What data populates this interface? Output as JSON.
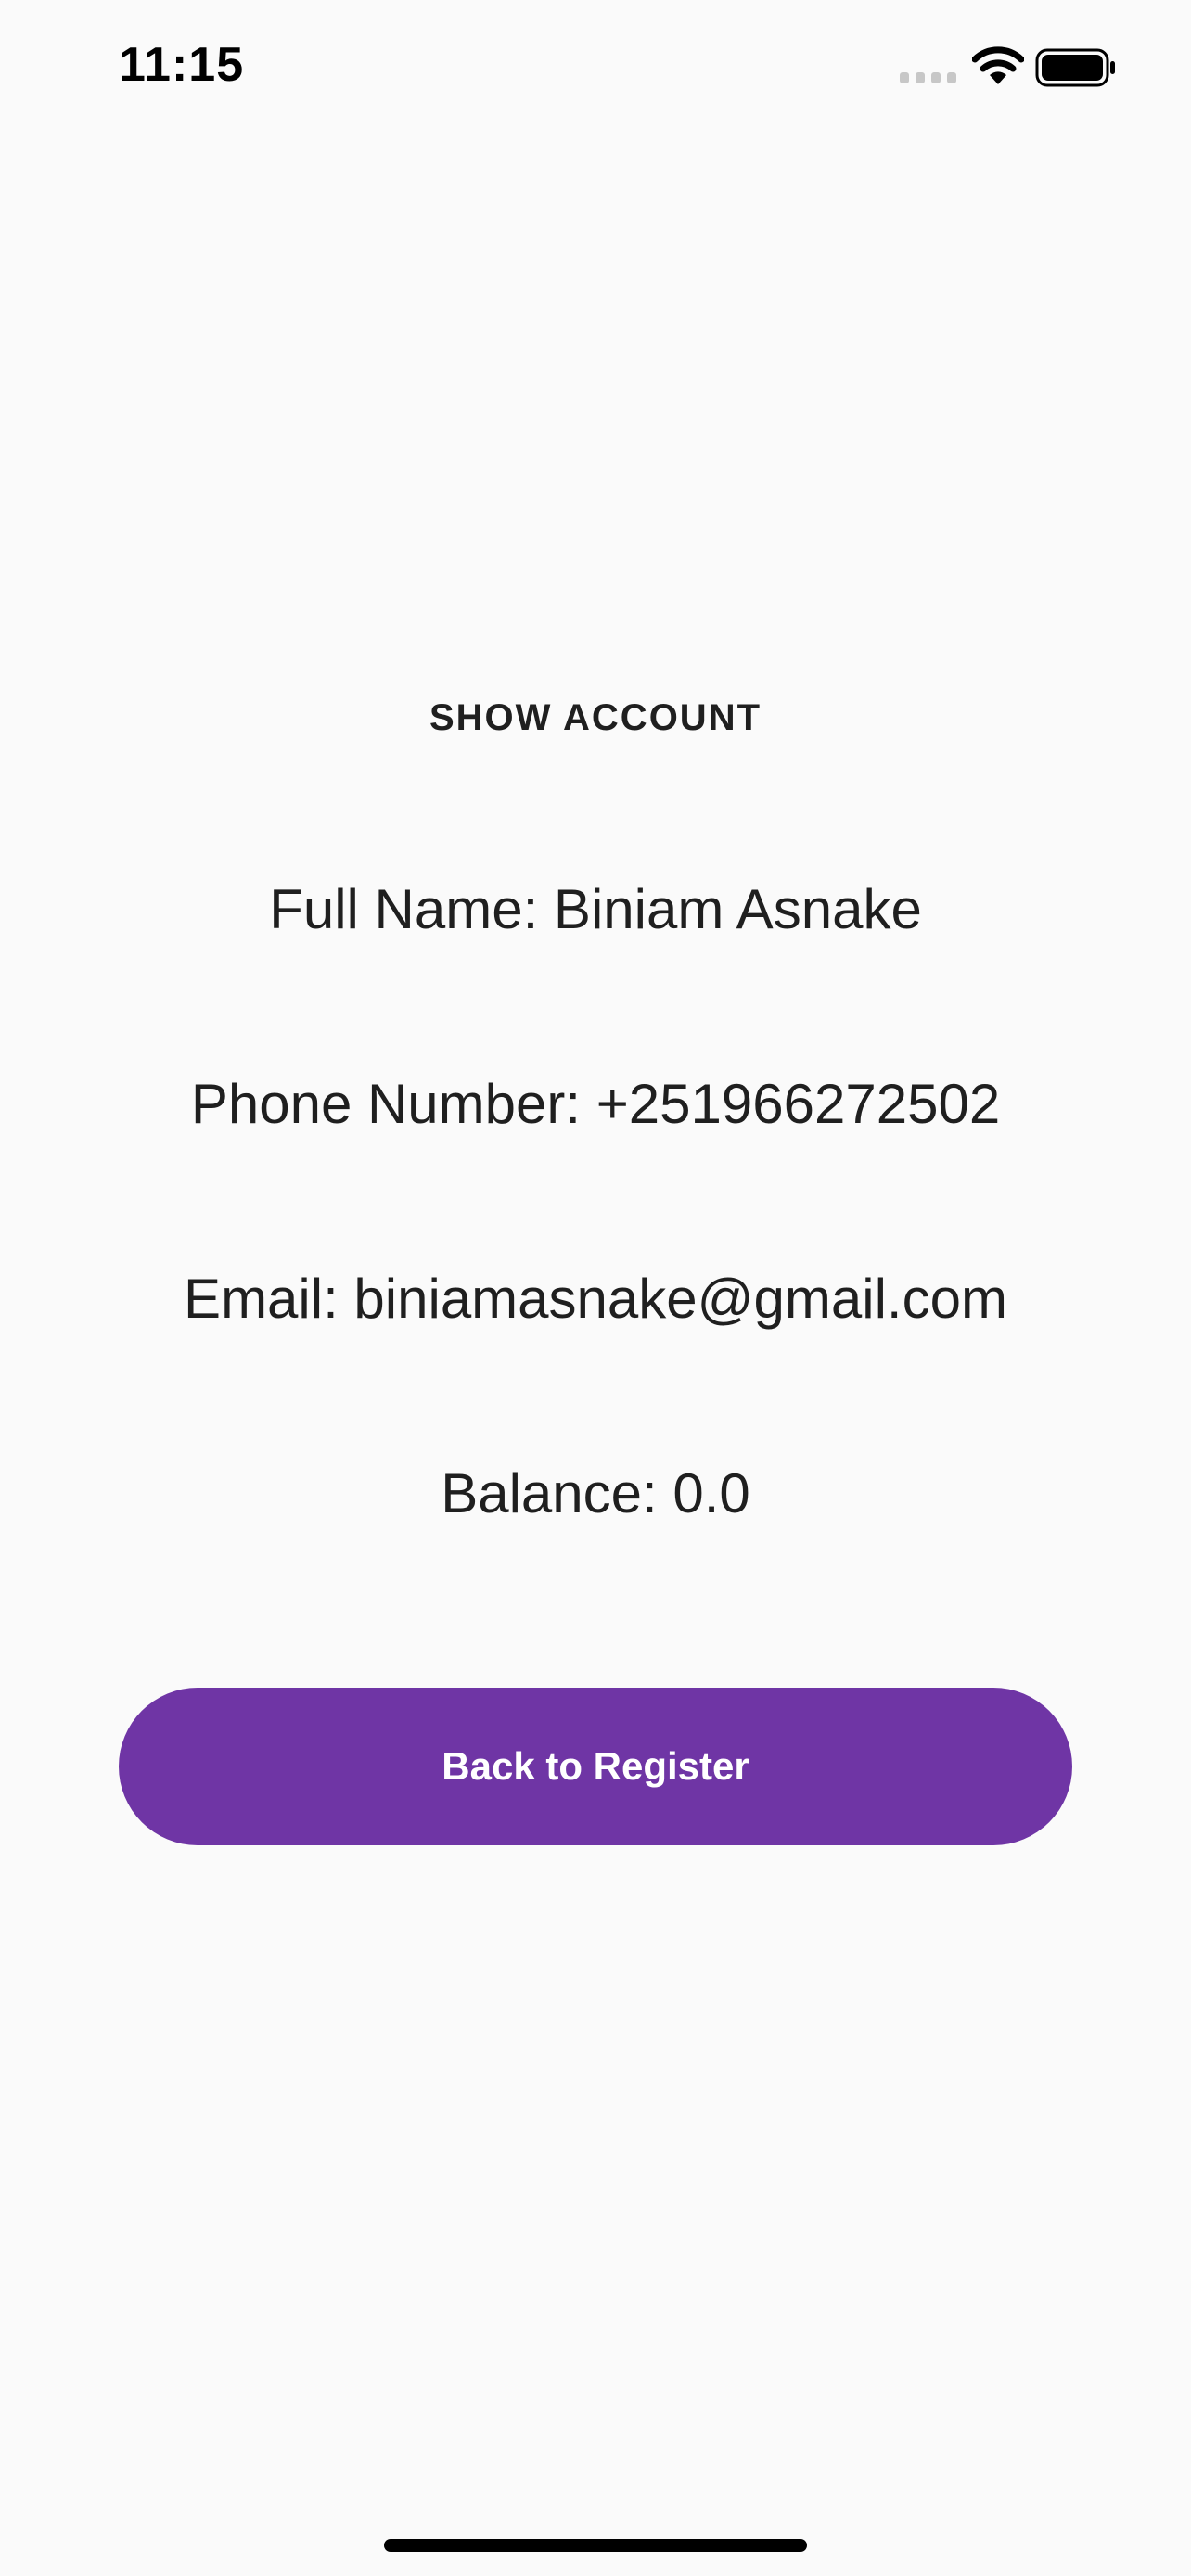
{
  "status_bar": {
    "time": "11:15",
    "icons": [
      "signal-icon",
      "wifi-icon",
      "battery-icon"
    ]
  },
  "page": {
    "title": "SHOW ACCOUNT",
    "full_name": "Full Name: Biniam Asnake",
    "phone_number": "Phone Number: +251966272502",
    "email": "Email: biniamasnake@gmail.com",
    "balance": "Balance: 0.0"
  },
  "actions": {
    "back_to_register_label": "Back to Register"
  },
  "colors": {
    "background": "#fafafa",
    "button_primary": "#6f35a5",
    "button_text": "#ffffff",
    "text_primary": "#1f1f1f"
  }
}
